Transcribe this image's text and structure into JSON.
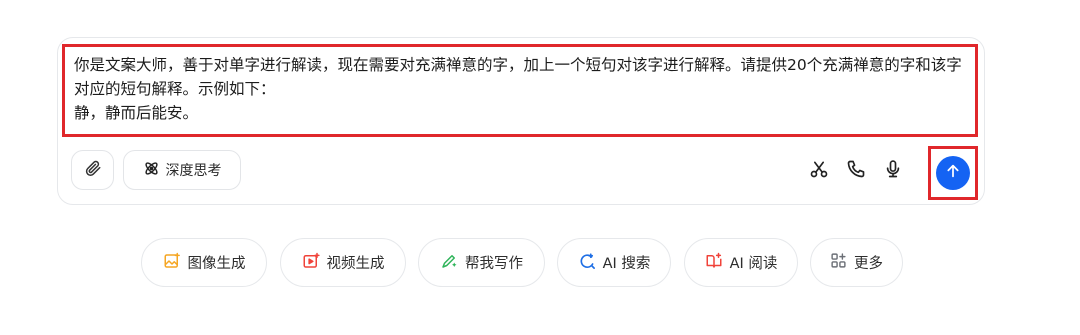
{
  "prompt": {
    "text": "你是文案大师，善于对单字进行解读，现在需要对充满禅意的字，加上一个短句对该字进行解释。请提供20个充满禅意的字和该字对应的短句解释。示例如下：\n静，静而后能安。"
  },
  "toolbar": {
    "attach_icon": "paperclip-icon",
    "deep_think_label": "深度思考",
    "deep_think_icon": "atom-icon",
    "scissors_icon": "scissors-icon",
    "phone_icon": "phone-icon",
    "mic_icon": "microphone-icon",
    "send_icon": "arrow-up-icon"
  },
  "chips": [
    {
      "label": "图像生成",
      "icon": "image-gen-icon",
      "color": "#f5a623"
    },
    {
      "label": "视频生成",
      "icon": "video-gen-icon",
      "color": "#f0433a"
    },
    {
      "label": "帮我写作",
      "icon": "pen-icon",
      "color": "#2fb45a"
    },
    {
      "label": "AI 搜索",
      "icon": "search-icon",
      "color": "#1f6fe5"
    },
    {
      "label": "AI 阅读",
      "icon": "reader-icon",
      "color": "#f0433a"
    },
    {
      "label": "更多",
      "icon": "grid-icon",
      "color": "#6b6f76"
    }
  ],
  "colors": {
    "accent": "#1463f3",
    "highlight": "#e0272b"
  }
}
